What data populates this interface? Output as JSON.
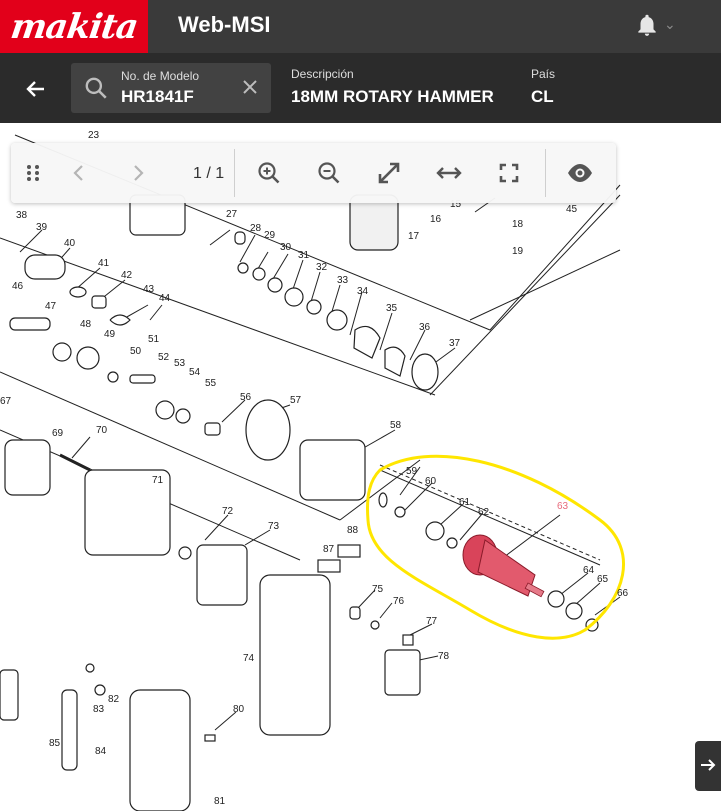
{
  "header": {
    "brand": "makita",
    "app_title": "Web-MSI",
    "icons": {
      "notifications": "bell-icon",
      "menu": "chevron-down-icon"
    }
  },
  "model_bar": {
    "back_icon": "arrow-left-icon",
    "model_label": "No. de Modelo",
    "model_value": "HR1841F",
    "description_label": "Descripción",
    "description_value": "18MM ROTARY HAMMER",
    "country_label": "País",
    "country_value": "CL"
  },
  "viewer_toolbar": {
    "page_indicator": "1 / 1",
    "icons": [
      "drag-handle-icon",
      "chevron-left-icon",
      "chevron-right-icon",
      "zoom-in-icon",
      "zoom-out-icon",
      "fit-diagonal-icon",
      "fit-width-icon",
      "fullscreen-icon",
      "eye-icon"
    ]
  },
  "diagram": {
    "highlighted_part": "63",
    "highlight_color": "#ffe600",
    "part_color": "#d9445a",
    "labels": [
      "23",
      "15",
      "18",
      "19",
      "45",
      "38",
      "39",
      "40",
      "41",
      "42",
      "43",
      "44",
      "46",
      "47",
      "48",
      "49",
      "50",
      "51",
      "52",
      "53",
      "54",
      "55",
      "56",
      "57",
      "27",
      "28",
      "29",
      "30",
      "31",
      "32",
      "33",
      "34",
      "35",
      "36",
      "37",
      "16",
      "17",
      "58",
      "59",
      "60",
      "61",
      "62",
      "63",
      "64",
      "65",
      "66",
      "67",
      "69",
      "70",
      "71",
      "72",
      "73",
      "87",
      "88",
      "75",
      "76",
      "77",
      "78",
      "74",
      "82",
      "83",
      "84",
      "85",
      "80",
      "81"
    ]
  },
  "colors": {
    "brand_red": "#e2001a",
    "topbar": "#3a3a3a",
    "subbar": "#2b2b2b"
  }
}
